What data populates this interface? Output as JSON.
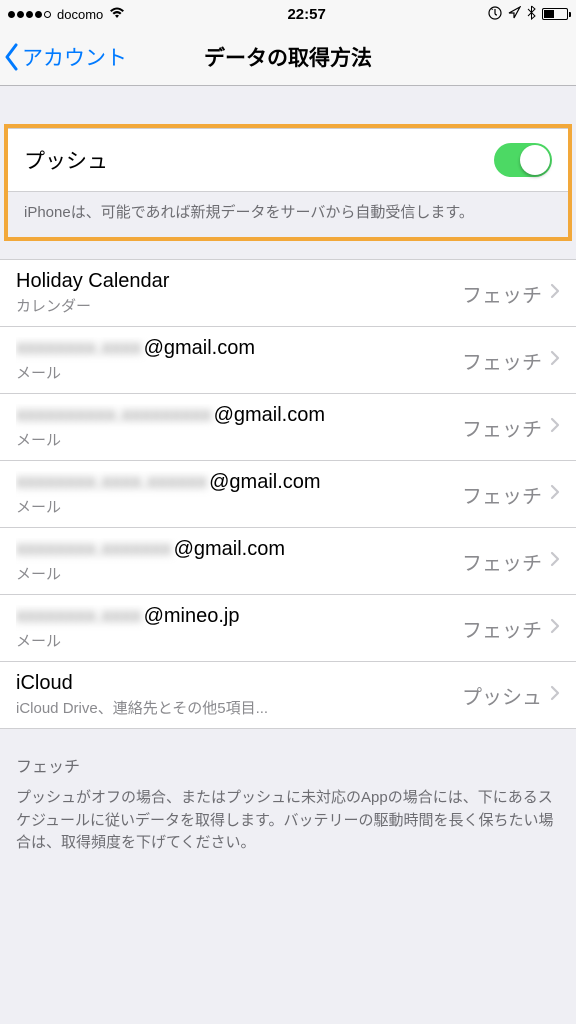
{
  "status": {
    "carrier": "docomo",
    "time": "22:57",
    "icons": {
      "rotation_lock": "⊕",
      "location": "➤",
      "bluetooth": "✱"
    }
  },
  "nav": {
    "back_label": "アカウント",
    "title": "データの取得方法"
  },
  "push": {
    "label": "プッシュ",
    "enabled": true,
    "footer": "iPhoneは、可能であれば新規データをサーバから自動受信します。"
  },
  "accounts": [
    {
      "title": "Holiday Calendar",
      "sub": "カレンダー",
      "value": "フェッチ",
      "blurred": false,
      "domain": null
    },
    {
      "title": "xxxxxxxx.xxxx",
      "domain": "@gmail.com",
      "sub": "メール",
      "value": "フェッチ",
      "blurred": true
    },
    {
      "title": "xxxxxxxxxx.xxxxxxxxx",
      "domain": "@gmail.com",
      "sub": "メール",
      "value": "フェッチ",
      "blurred": true
    },
    {
      "title": "xxxxxxxx.xxxx.xxxxxx",
      "domain": "@gmail.com",
      "sub": "メール",
      "value": "フェッチ",
      "blurred": true
    },
    {
      "title": "xxxxxxxx.xxxxxxx",
      "domain": "@gmail.com",
      "sub": "メール",
      "value": "フェッチ",
      "blurred": true
    },
    {
      "title": "xxxxxxxx.xxxx",
      "domain": "@mineo.jp",
      "sub": "メール",
      "value": "フェッチ",
      "blurred": true
    },
    {
      "title": "iCloud",
      "sub": "iCloud Drive、連絡先とその他5項目...",
      "value": "プッシュ",
      "blurred": false,
      "domain": null
    }
  ],
  "fetch_section": {
    "header": "フェッチ",
    "footer": "プッシュがオフの場合、またはプッシュに未対応のAppの場合には、下にあるスケジュールに従いデータを取得します。バッテリーの駆動時間を長く保ちたい場合は、取得頻度を下げてください。"
  }
}
